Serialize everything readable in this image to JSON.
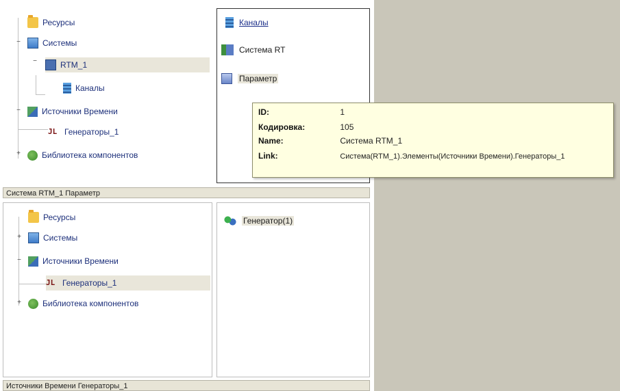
{
  "top_tree": {
    "items": [
      {
        "label": "Ресурсы"
      },
      {
        "label": "Системы"
      },
      {
        "label": "RTM_1"
      },
      {
        "label": "Каналы"
      },
      {
        "label": "Источники Времени"
      },
      {
        "label": "Генераторы_1"
      },
      {
        "label": "Библиотека компонентов"
      }
    ]
  },
  "top_right": {
    "items": [
      {
        "label": "Каналы"
      },
      {
        "label": "Система RT"
      },
      {
        "label": "Параметр"
      }
    ]
  },
  "tooltip": {
    "rows": [
      {
        "key": "ID:",
        "value": "1"
      },
      {
        "key": "Кодировка:",
        "value": "105"
      },
      {
        "key": "Name:",
        "value": "Система RTM_1"
      },
      {
        "key": "Link:",
        "value": "Система(RTM_1).Элементы(Источники Времени).Генераторы_1"
      }
    ]
  },
  "status_top": "Система RTM_1 Параметр",
  "bottom_tree": {
    "items": [
      {
        "label": "Ресурсы"
      },
      {
        "label": "Системы"
      },
      {
        "label": "Источники Времени"
      },
      {
        "label": "Генераторы_1"
      },
      {
        "label": "Библиотека компонентов"
      }
    ]
  },
  "bottom_right": {
    "items": [
      {
        "label": "Генератор(1)"
      }
    ]
  },
  "status_bottom": "Источники Времени Генераторы_1",
  "colors": {
    "desktop": "#c9c6b9",
    "tooltip_bg": "#ffffe1",
    "link": "#1c2f8a",
    "status_bg": "#e7e4d6"
  }
}
